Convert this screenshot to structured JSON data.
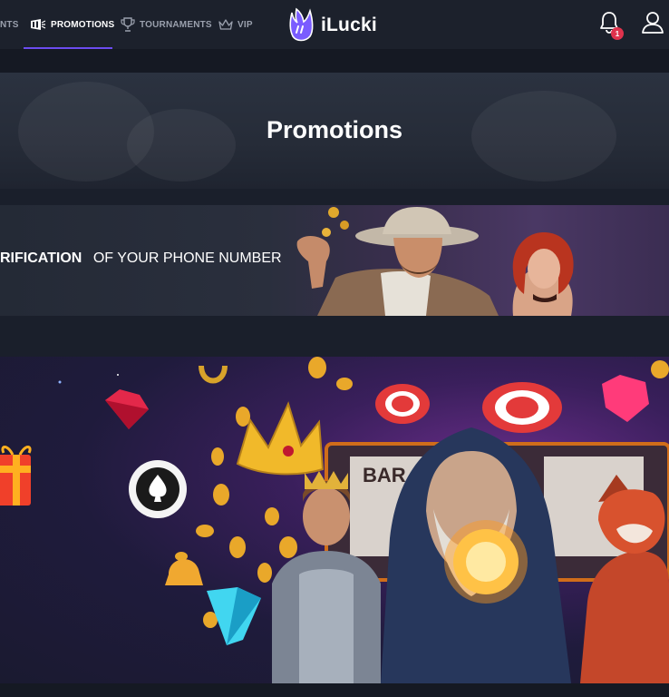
{
  "nav": {
    "items": [
      {
        "label": "NTS",
        "icon": "tournament-partial"
      },
      {
        "label": "PROMOTIONS",
        "icon": "promotions-icon"
      },
      {
        "label": "TOURNAMENTS",
        "icon": "trophy-icon"
      },
      {
        "label": "VIP",
        "icon": "crown-icon"
      }
    ],
    "active": "PROMOTIONS",
    "notification_count": "1"
  },
  "logo": {
    "text": "iLucki"
  },
  "hero": {
    "title": "Promotions"
  },
  "promos": [
    {
      "text_bold": "RIFICATION",
      "text_regular": "OF YOUR PHONE NUMBER"
    },
    {
      "text_bold": "",
      "text_regular": ""
    }
  ],
  "colors": {
    "background": "#1a1f2b",
    "nav_bg": "#1c212c",
    "accent": "#6c4cf0",
    "badge": "#e0334d"
  }
}
